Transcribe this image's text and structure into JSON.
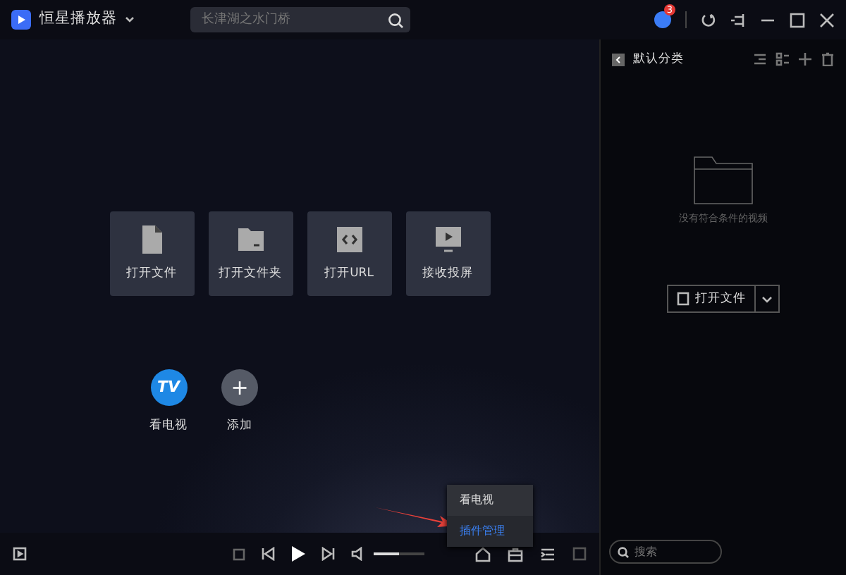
{
  "window": {
    "title": "恒星播放器",
    "search": {
      "placeholder": "长津湖之水门桥"
    },
    "notification_badge": "3"
  },
  "tiles": [
    {
      "kind": "file",
      "label": "打开文件"
    },
    {
      "kind": "folder",
      "label": "打开文件夹"
    },
    {
      "kind": "url",
      "label": "打开URL"
    },
    {
      "kind": "cast",
      "label": "接收投屏"
    }
  ],
  "shortcuts": [
    {
      "kind": "tv",
      "icon_text": "TV",
      "label": "看电视"
    },
    {
      "kind": "add",
      "icon_text": "+",
      "label": "添加"
    }
  ],
  "context_menu": [
    {
      "label": "看电视",
      "selected": false
    },
    {
      "label": "插件管理",
      "selected": true
    }
  ],
  "player": {
    "volume": {
      "level": 0.5
    }
  },
  "sidebar": {
    "title": "默认分类",
    "empty_text": "没有符合条件的视频",
    "open_button": "打开文件",
    "search": {
      "placeholder": "搜索"
    }
  }
}
